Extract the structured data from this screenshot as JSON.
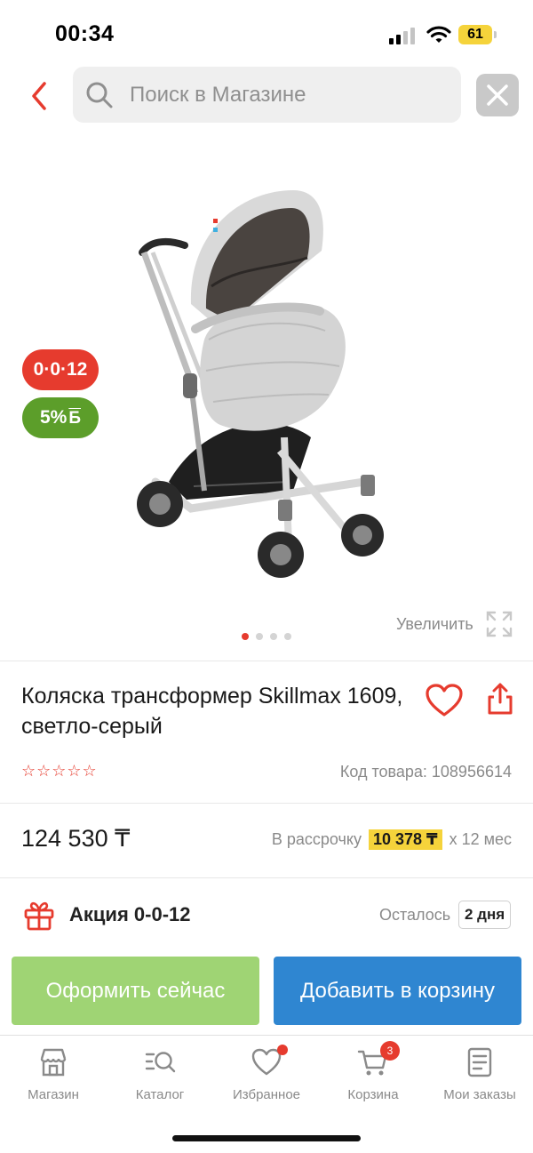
{
  "status_bar": {
    "time": "00:34",
    "battery": "61"
  },
  "search": {
    "placeholder": "Поиск в Магазине"
  },
  "gallery": {
    "badge_installment": "0·0·12",
    "badge_bonus_percent": "5%",
    "badge_bonus_symbol": "Б",
    "zoom_label": "Увеличить",
    "slide_count": 4,
    "active_slide": 1
  },
  "product": {
    "title": "Коляска трансформер Skillmax 1609, светло-серый",
    "rating_stars": "☆☆☆☆☆",
    "code": "Код товара: 108956614"
  },
  "price": {
    "value": "124 530 ₸",
    "installment_prefix": "В рассрочку",
    "installment_amount": "10 378 ₸",
    "installment_suffix": "x 12 мес"
  },
  "promo": {
    "label": "Акция 0-0-12",
    "remaining_label": "Осталось",
    "remaining_value": "2 дня"
  },
  "actions": {
    "checkout_label": "Оформить сейчас",
    "add_to_cart_label": "Добавить в корзину"
  },
  "tabs": [
    {
      "label": "Магазин",
      "icon": "store-icon"
    },
    {
      "label": "Каталог",
      "icon": "catalog-search-icon"
    },
    {
      "label": "Избранное",
      "icon": "heart-icon"
    },
    {
      "label": "Корзина",
      "icon": "cart-icon",
      "badge": "3"
    },
    {
      "label": "Мои заказы",
      "icon": "orders-icon"
    }
  ],
  "colors": {
    "accent_red": "#e63b2e",
    "green": "#5c9e2a",
    "blue": "#2f86d1",
    "yellow": "#f5d33b",
    "light_green": "#9fd474"
  }
}
